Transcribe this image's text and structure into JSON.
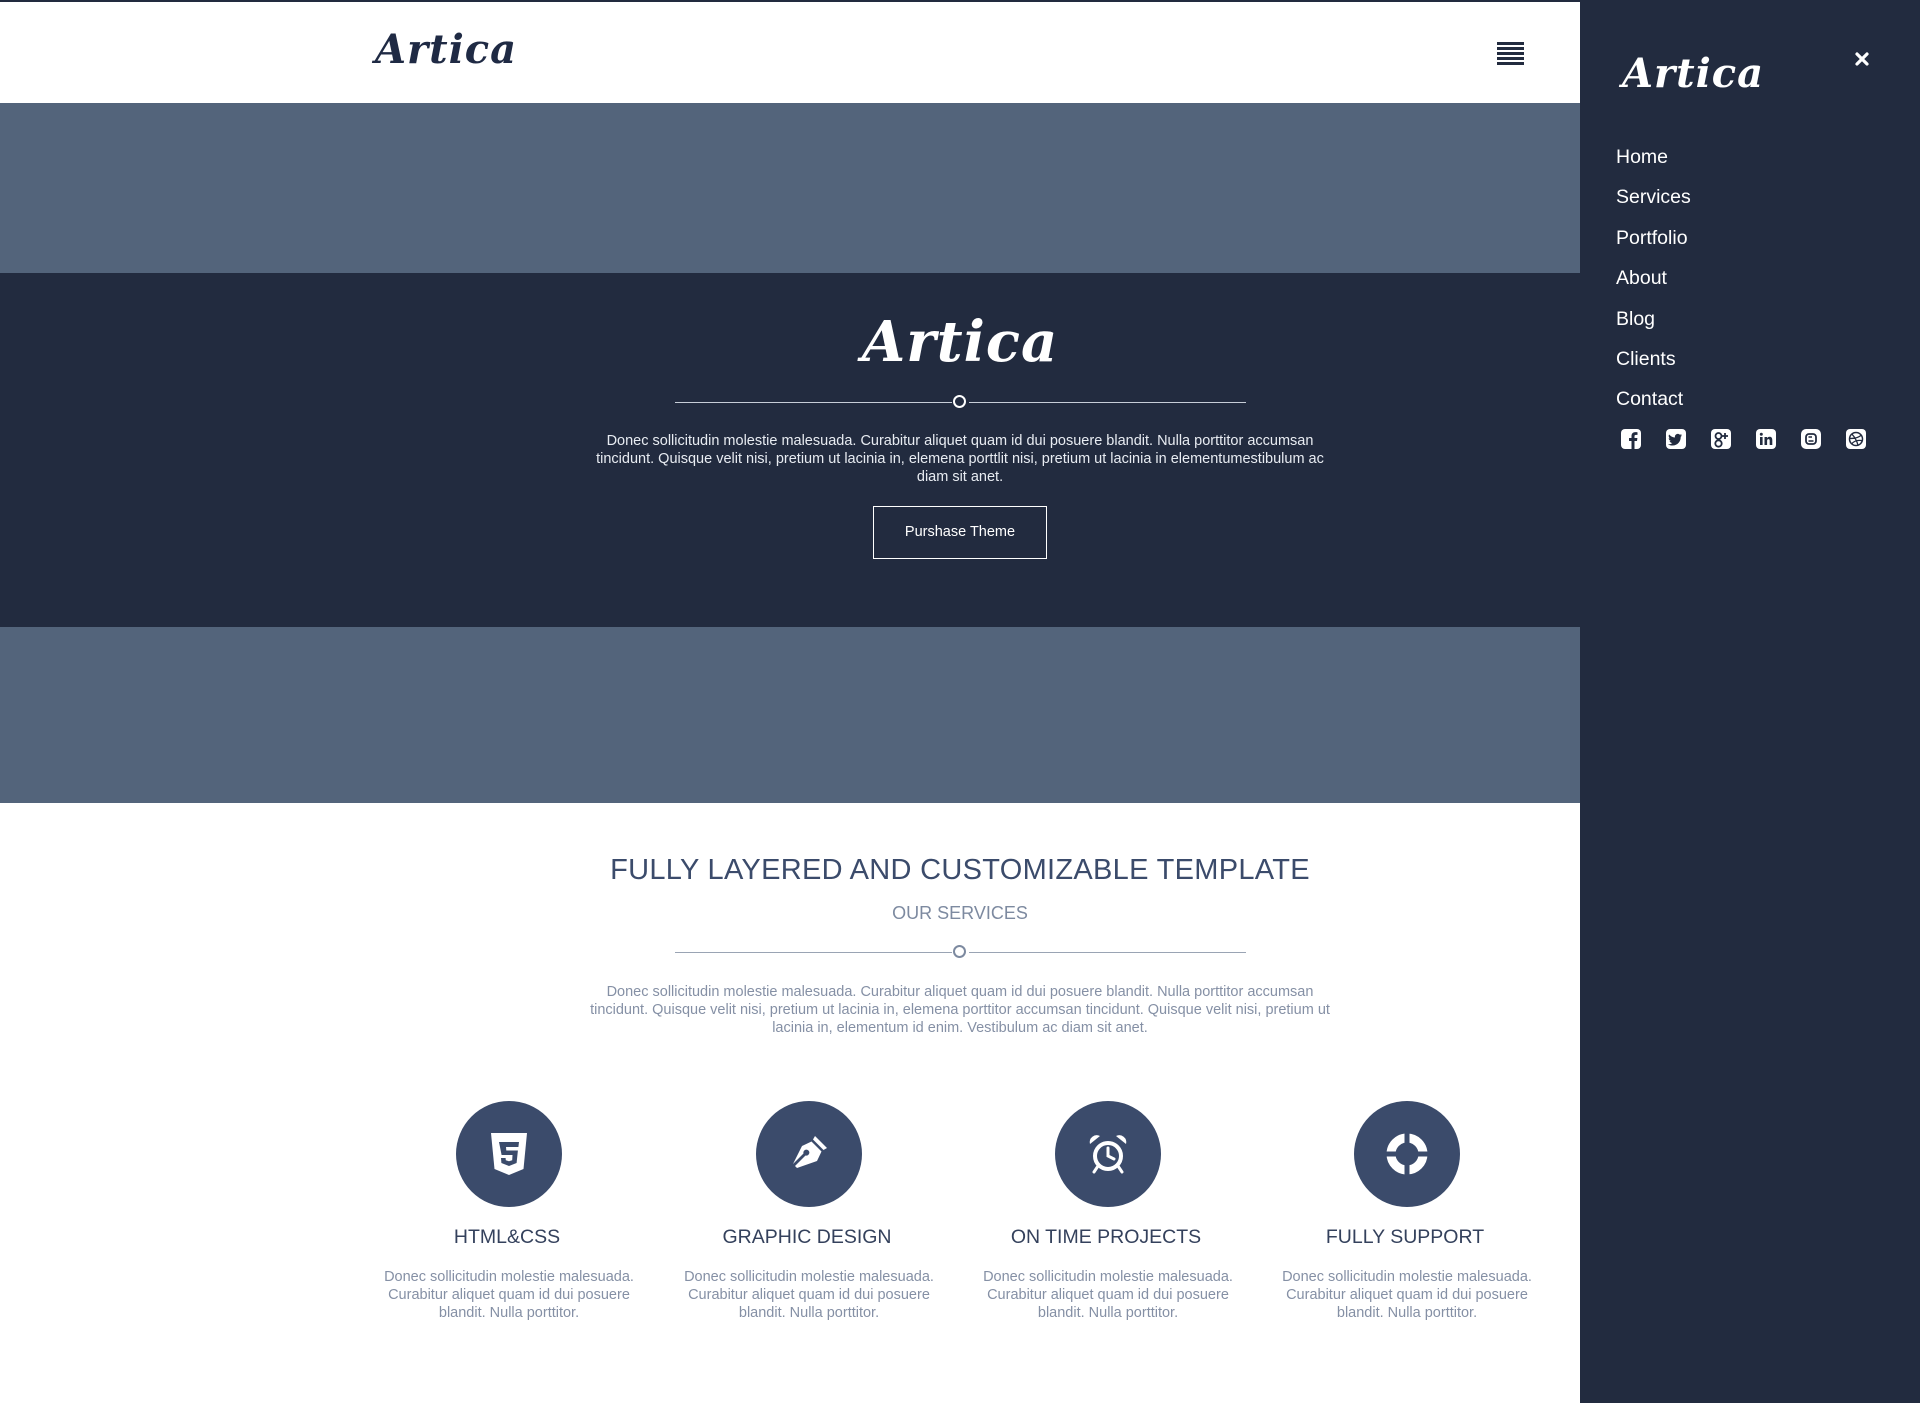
{
  "brand": {
    "logo_text": "Artica"
  },
  "hero": {
    "logo_text": "Artica",
    "description": "Donec sollicitudin molestie malesuada. Curabitur aliquet quam id dui posuere blandit. Nulla porttitor accumsan tincidunt. Quisque velit nisi, pretium ut lacinia in, elemena porttlit nisi, pretium ut lacinia in elementumestibulum ac diam sit anet.",
    "button_label": "Purshase Theme"
  },
  "services": {
    "title": "FULLY LAYERED AND CUSTOMIZABLE TEMPLATE",
    "subtitle": "OUR SERVICES",
    "description": "Donec sollicitudin molestie malesuada. Curabitur aliquet quam id dui posuere blandit. Nulla porttitor accumsan tincidunt. Quisque velit nisi, pretium ut lacinia in, elemena porttitor accumsan tincidunt. Quisque velit nisi, pretium ut lacinia in, elementum id enim. Vestibulum ac diam sit anet.",
    "items": [
      {
        "icon": "css3-icon",
        "title": "HTML&CSS",
        "text": "Donec sollicitudin molestie malesuada. Curabitur aliquet quam id dui posuere blandit. Nulla porttitor."
      },
      {
        "icon": "pen-nib-icon",
        "title": "GRAPHIC DESIGN",
        "text": "Donec sollicitudin molestie malesuada. Curabitur aliquet quam id dui posuere blandit. Nulla porttitor."
      },
      {
        "icon": "alarm-clock-icon",
        "title": "ON TIME PROJECTS",
        "text": "Donec sollicitudin molestie malesuada. Curabitur aliquet quam id dui posuere blandit. Nulla porttitor."
      },
      {
        "icon": "life-ring-icon",
        "title": "FULLY SUPPORT",
        "text": "Donec sollicitudin molestie malesuada. Curabitur aliquet quam id dui posuere blandit. Nulla porttitor."
      }
    ]
  },
  "sidebar": {
    "logo_text": "Artica",
    "close_icon": "close-icon",
    "menu": [
      "Home",
      "Services",
      "Portfolio",
      "About",
      "Blog",
      "Clients",
      "Contact"
    ],
    "social": [
      "facebook-icon",
      "twitter-icon",
      "google-plus-icon",
      "linkedin-icon",
      "blogger-icon",
      "dribbble-icon"
    ]
  },
  "colors": {
    "dark_navy": "#222b3f",
    "slate_band": "#53647b",
    "accent": "#3b4b6b",
    "muted_text": "#8590a5"
  }
}
